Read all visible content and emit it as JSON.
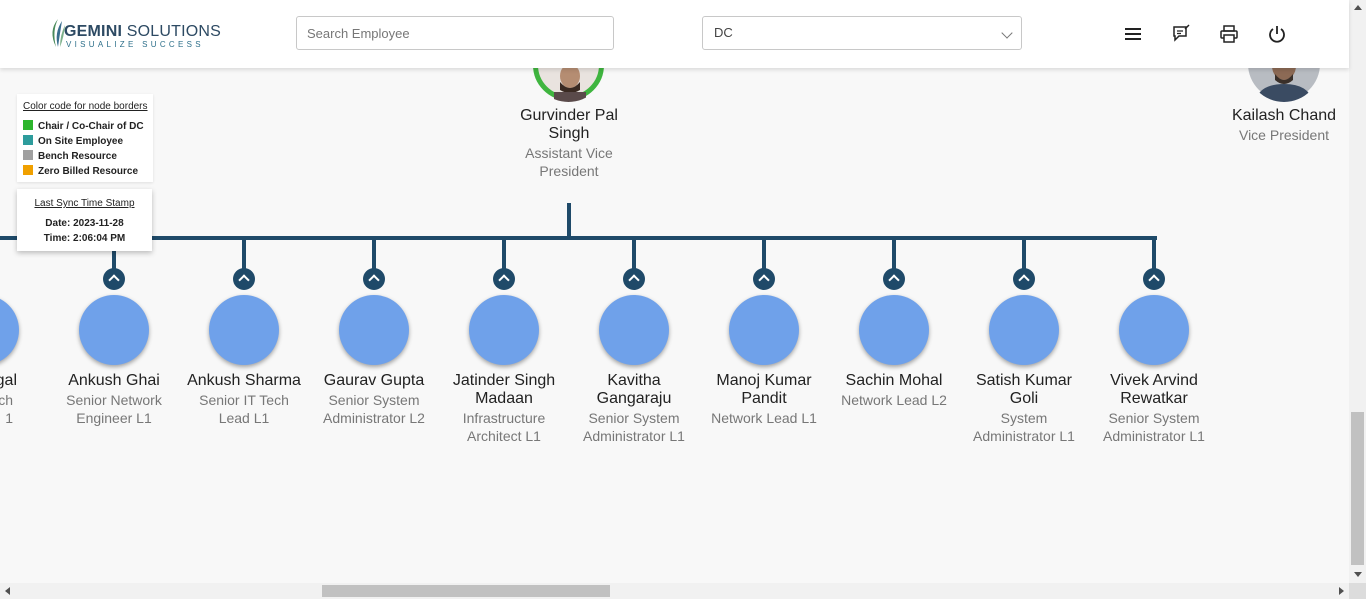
{
  "header": {
    "logo_brand": "GEMINI",
    "logo_brand_suffix": "SOLUTIONS",
    "logo_tagline": "VISUALIZE SUCCESS",
    "search_placeholder": "Search Employee",
    "selected_department": "DC",
    "icons": [
      "menu-icon",
      "feedback-icon",
      "print-icon",
      "power-icon"
    ]
  },
  "legend": {
    "title": "Color code for node borders",
    "items": [
      {
        "label": "Chair / Co-Chair of DC",
        "color": "#2cb52c"
      },
      {
        "label": "On Site Employee",
        "color": "#2d9c9c"
      },
      {
        "label": "Bench Resource",
        "color": "#a0a0a0"
      },
      {
        "label": "Zero Billed Resource",
        "color": "#f0a000"
      }
    ]
  },
  "sync": {
    "title": "Last Sync Time Stamp",
    "date": "Date: 2023-11-28",
    "time": "Time: 2:06:04 PM"
  },
  "managers": [
    {
      "name_line1": "Gurvinder Pal",
      "name_line2": "Singh",
      "title_line1": "Assistant Vice",
      "title_line2": "President",
      "border_color": "#2cb52c"
    },
    {
      "name_line1": "Kailash Chand",
      "name_line2": "",
      "title_line1": "Vice President",
      "title_line2": ""
    }
  ],
  "employees": [
    {
      "name": [
        "ehgal"
      ],
      "title": [
        "Tech",
        "1"
      ]
    },
    {
      "name": [
        "Ankush Ghai"
      ],
      "title": [
        "Senior Network",
        "Engineer L1"
      ]
    },
    {
      "name": [
        "Ankush Sharma"
      ],
      "title": [
        "Senior IT Tech",
        "Lead L1"
      ]
    },
    {
      "name": [
        "Gaurav Gupta"
      ],
      "title": [
        "Senior System",
        "Administrator L2"
      ]
    },
    {
      "name": [
        "Jatinder Singh",
        "Madaan"
      ],
      "title": [
        "Infrastructure",
        "Architect L1"
      ]
    },
    {
      "name": [
        "Kavitha",
        "Gangaraju"
      ],
      "title": [
        "Senior System",
        "Administrator L1"
      ]
    },
    {
      "name": [
        "Manoj Kumar",
        "Pandit"
      ],
      "title": [
        "Network Lead L1"
      ]
    },
    {
      "name": [
        "Sachin Mohal"
      ],
      "title": [
        "Network Lead L2"
      ]
    },
    {
      "name": [
        "Satish Kumar",
        "Goli"
      ],
      "title": [
        "System",
        "Administrator L1"
      ]
    },
    {
      "name": [
        "Vivek Arvind",
        "Rewatkar"
      ],
      "title": [
        "Senior System",
        "Administrator L1"
      ]
    }
  ]
}
